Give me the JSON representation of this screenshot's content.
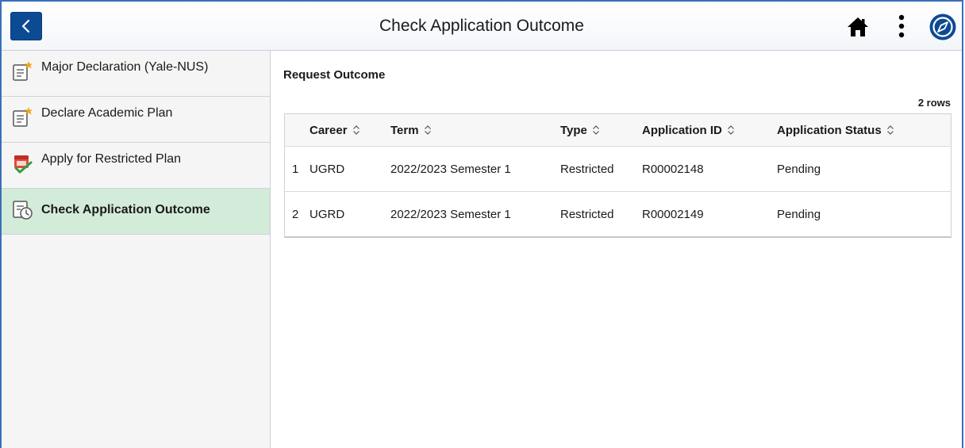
{
  "header": {
    "title": "Check Application Outcome",
    "back_label": "Back",
    "icons": [
      "chevron-left-icon",
      "home-icon",
      "more-vertical-icon",
      "compass-icon"
    ],
    "accent_color": "#0c4a94"
  },
  "sidebar": {
    "items": [
      {
        "label": "Major Declaration (Yale-NUS)",
        "icon": "form-new-icon",
        "active": false
      },
      {
        "label": "Declare Academic Plan",
        "icon": "form-new-icon",
        "active": false
      },
      {
        "label": "Apply for Restricted Plan",
        "icon": "calendar-check-icon",
        "active": false
      },
      {
        "label": "Check Application Outcome",
        "icon": "clock-document-icon",
        "active": true
      }
    ],
    "active_color": "#d2ecd9"
  },
  "main": {
    "section_title": "Request Outcome",
    "row_count": "2 rows",
    "table": {
      "columns": [
        "Career",
        "Term",
        "Type",
        "Application ID",
        "Application Status"
      ],
      "rows": [
        {
          "num": "1",
          "career": "UGRD",
          "term": "2022/2023 Semester 1",
          "type": "Restricted",
          "app_id": "R00002148",
          "status": "Pending"
        },
        {
          "num": "2",
          "career": "UGRD",
          "term": "2022/2023 Semester 1",
          "type": "Restricted",
          "app_id": "R00002149",
          "status": "Pending"
        }
      ]
    }
  }
}
